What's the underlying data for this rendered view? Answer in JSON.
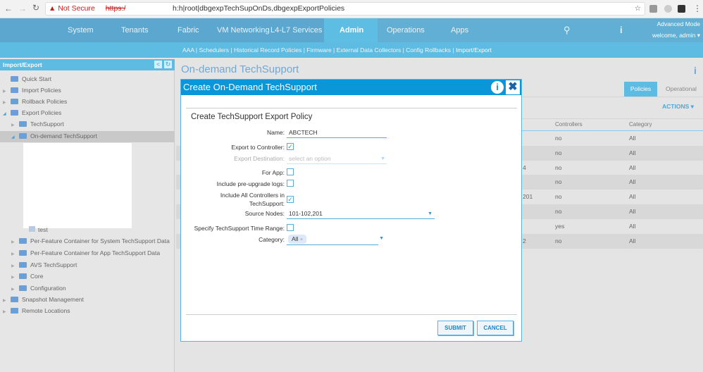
{
  "browser": {
    "security": "Not Secure",
    "url_scheme": "https:/",
    "url_path": "h:h|root|dbgexpTechSupOnDs,dbgexpExportPolicies"
  },
  "topnav": {
    "logo": "cisco",
    "items": [
      "System",
      "Tenants",
      "Fabric",
      "VM Networking",
      "L4-L7 Services",
      "Admin",
      "Operations",
      "Apps"
    ],
    "active": "Admin",
    "mode": "Advanced Mode",
    "user": "welcome, admin"
  },
  "subnav": {
    "items": [
      "AAA",
      "Schedulers",
      "Historical Record Policies",
      "Firmware",
      "External Data Collectors",
      "Config Rollbacks",
      "Import/Export"
    ]
  },
  "sidebar": {
    "title": "Import/Export",
    "items": [
      {
        "label": "Quick Start",
        "level": 0
      },
      {
        "label": "Import Policies",
        "level": 0
      },
      {
        "label": "Rollback Policies",
        "level": 0
      },
      {
        "label": "Export Policies",
        "level": 0
      },
      {
        "label": "TechSupport",
        "level": 1
      },
      {
        "label": "On-demand TechSupport",
        "level": 1
      },
      {
        "label": "test",
        "level": 2
      },
      {
        "label": "Per-Feature Container for System TechSupport Data",
        "level": 1
      },
      {
        "label": "Per-Feature Container for App TechSupport Data",
        "level": 1
      },
      {
        "label": "AVS TechSupport",
        "level": 1
      },
      {
        "label": "Core",
        "level": 1
      },
      {
        "label": "Configuration",
        "level": 1
      },
      {
        "label": "Snapshot Management",
        "level": 0
      },
      {
        "label": "Remote Locations",
        "level": 0
      }
    ]
  },
  "main": {
    "title": "On-demand TechSupport",
    "tabs": [
      "Policies",
      "Operational"
    ],
    "actions": "ACTIONS",
    "columns": [
      "Controllers",
      "Category"
    ],
    "rows": [
      {
        "partial": "",
        "controllers": "no",
        "category": "All"
      },
      {
        "partial": "",
        "controllers": "no",
        "category": "All"
      },
      {
        "partial": "4",
        "controllers": "no",
        "category": "All"
      },
      {
        "partial": "",
        "controllers": "no",
        "category": "All"
      },
      {
        "partial": "201",
        "controllers": "no",
        "category": "All"
      },
      {
        "partial": "",
        "controllers": "no",
        "category": "All"
      },
      {
        "partial": "",
        "controllers": "yes",
        "category": "All"
      },
      {
        "partial": "2",
        "controllers": "no",
        "category": "All"
      }
    ]
  },
  "dialog": {
    "title": "Create On-Demand TechSupport",
    "section": "Create TechSupport Export Policy",
    "name_label": "Name:",
    "name_value": "ABCTECH",
    "export_controller_label": "Export to Controller:",
    "export_controller": true,
    "export_dest_label": "Export Destination:",
    "export_dest_placeholder": "select an option",
    "for_app_label": "For App:",
    "for_app": false,
    "preupgrade_label": "Include pre-upgrade logs:",
    "preupgrade": false,
    "all_ctrl_label1": "Include All Controllers in",
    "all_ctrl_label2": "TechSupport:",
    "all_ctrl": true,
    "source_nodes_label": "Source Nodes:",
    "source_nodes": "101-102,201",
    "time_range_label": "Specify TechSupport Time Range:",
    "time_range": false,
    "category_label": "Category:",
    "category_tag": "All",
    "submit": "SUBMIT",
    "cancel": "CANCEL"
  }
}
